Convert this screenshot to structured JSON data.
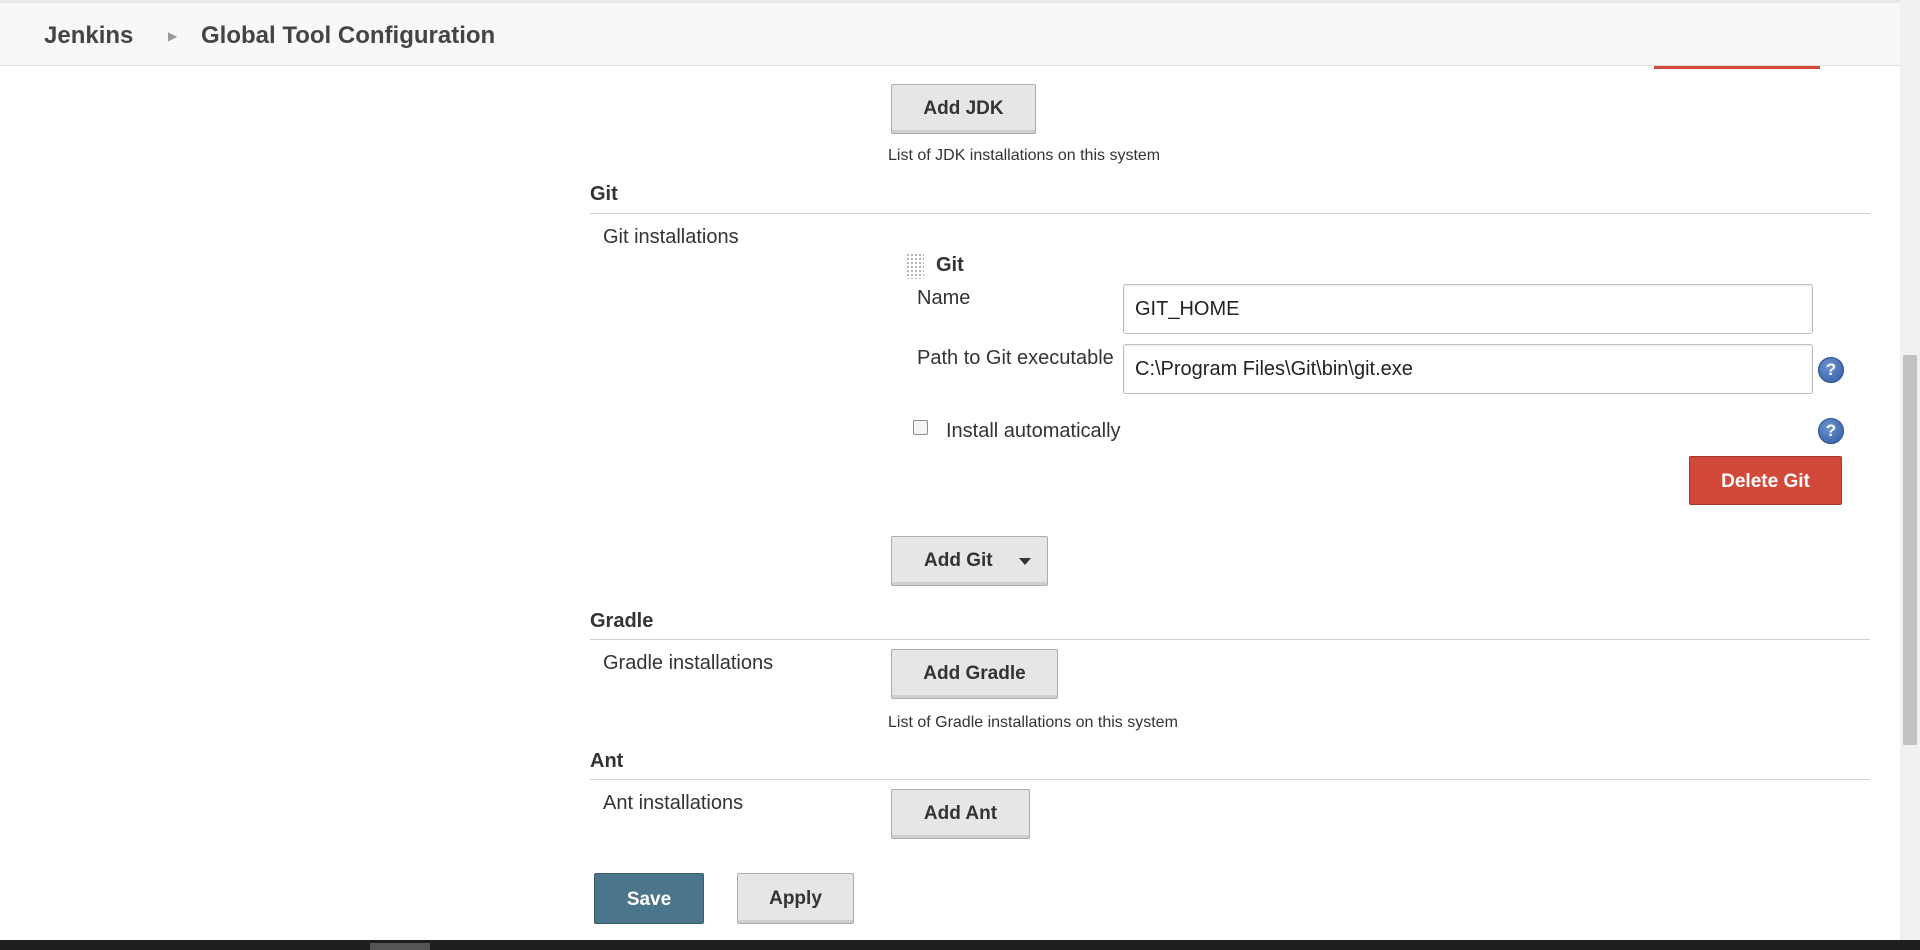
{
  "breadcrumb": {
    "home": "Jenkins",
    "current": "Global Tool Configuration"
  },
  "jdk": {
    "add_button": "Add JDK",
    "description": "List of JDK installations on this system"
  },
  "git": {
    "section_title": "Git",
    "installations_label": "Git installations",
    "item_title": "Git",
    "name_label": "Name",
    "name_value": "GIT_HOME",
    "path_label": "Path to Git executable",
    "path_value": "C:\\Program Files\\Git\\bin\\git.exe",
    "install_auto_label": "Install automatically",
    "install_auto_checked": false,
    "delete_button": "Delete Git",
    "add_button": "Add Git"
  },
  "gradle": {
    "section_title": "Gradle",
    "installations_label": "Gradle installations",
    "add_button": "Add Gradle",
    "description": "List of Gradle installations on this system"
  },
  "ant": {
    "section_title": "Ant",
    "installations_label": "Ant installations",
    "add_button": "Add Ant"
  },
  "footer": {
    "save_button": "Save",
    "apply_button": "Apply"
  },
  "icons": {
    "help": "help-icon",
    "dropdown": "caret-down-icon",
    "drag": "drag-handle-icon",
    "breadcrumb_separator": "chevron-right-icon"
  },
  "colors": {
    "danger": "#d24939",
    "primary": "#4b758b",
    "help": "#2f5aa5"
  }
}
